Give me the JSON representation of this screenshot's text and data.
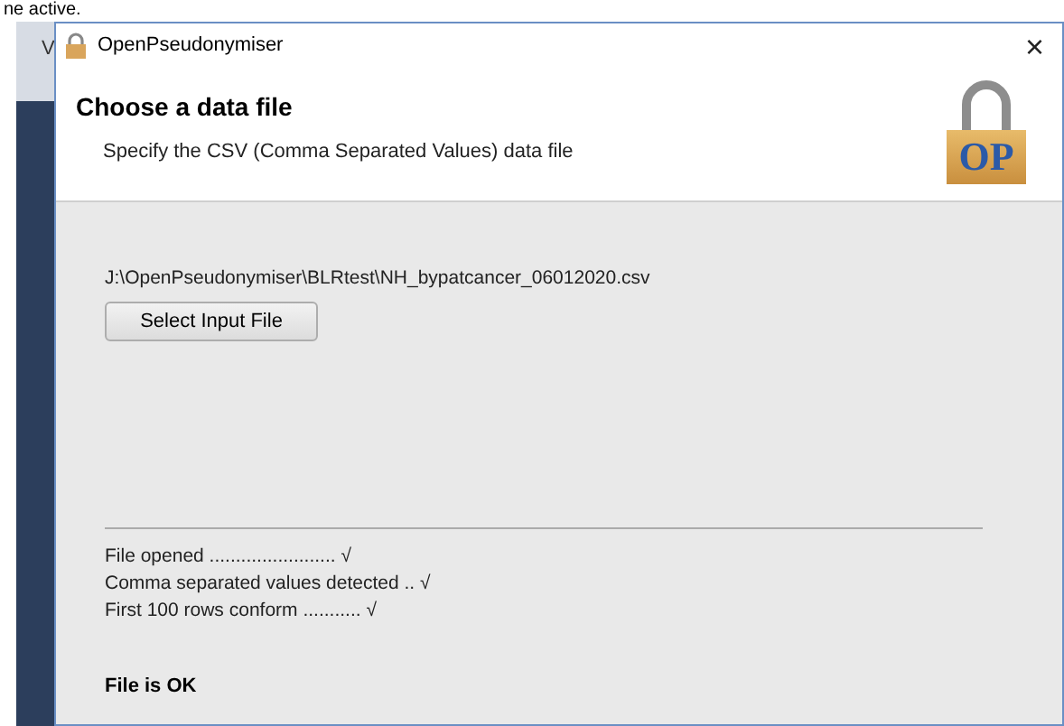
{
  "background_text": "ne active.",
  "background_window": {
    "fragment": "V"
  },
  "window": {
    "title": "OpenPseudonymiser",
    "close": "×"
  },
  "header": {
    "title": "Choose a data file",
    "subtitle": "Specify the CSV (Comma Separated Values) data file",
    "logo_text": "OP"
  },
  "file_path": "J:\\OpenPseudonymiser\\BLRtest\\NH_bypatcancer_06012020.csv",
  "select_button": "Select Input File",
  "checks": [
    {
      "text": "File opened ........................ √"
    },
    {
      "text": "Comma separated values detected .. √"
    },
    {
      "text": "First 100 rows conform ........... √"
    }
  ],
  "result": "File is OK"
}
